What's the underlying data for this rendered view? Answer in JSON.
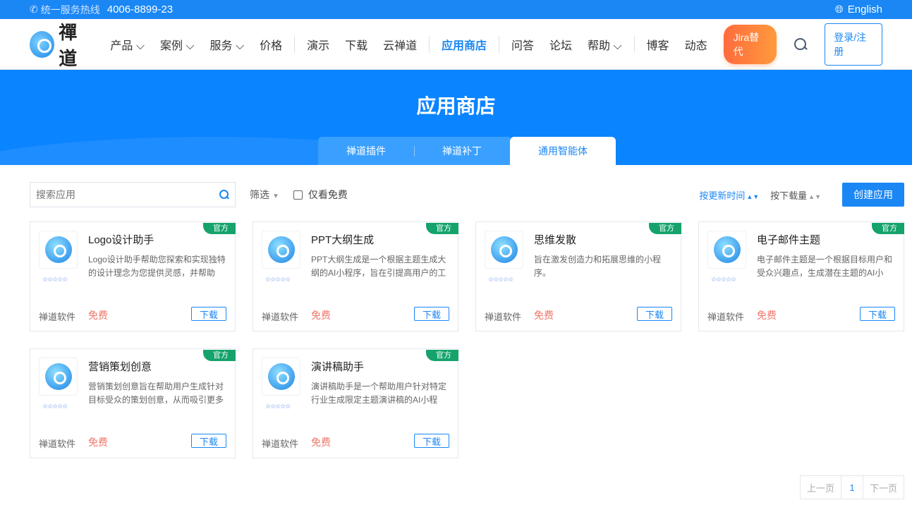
{
  "topbar": {
    "hotline_label": "统一服务热线",
    "phone": "4006-8899-23",
    "language": "English"
  },
  "nav": {
    "logo_text": "禪道",
    "items": [
      {
        "label": "产品 ⌵"
      },
      {
        "label": "案例 ⌵"
      },
      {
        "label": "服务 ⌵"
      },
      {
        "label": "价格"
      },
      {
        "label": "演示"
      },
      {
        "label": "下载"
      },
      {
        "label": "云禅道"
      },
      {
        "label": "应用商店"
      },
      {
        "label": "问答"
      },
      {
        "label": "论坛"
      },
      {
        "label": "帮助 ⌵"
      },
      {
        "label": "博客"
      },
      {
        "label": "动态"
      }
    ],
    "jira_label": "Jira替代",
    "login_label": "登录/注册"
  },
  "hero": {
    "title": "应用商店",
    "tabs": [
      {
        "label": "禅道插件"
      },
      {
        "label": "禅道补丁"
      },
      {
        "label": "通用智能体"
      }
    ]
  },
  "filter": {
    "search_placeholder": "搜索应用",
    "filter_label": "筛选",
    "free_only_label": "仅看免费",
    "sort_update": "按更新时间",
    "sort_downloads": "按下载量",
    "create_label": "创建应用"
  },
  "cards": [
    {
      "badge": "官方",
      "title": "Logo设计助手",
      "desc": "Logo设计助手帮助您探索和实现独特的设计理念为您提供灵感，并帮助",
      "stars": "☆☆☆☆☆",
      "vendor": "禅道软件",
      "price": "免费",
      "download": "下载"
    },
    {
      "badge": "官方",
      "title": "PPT大纲生成",
      "desc": "PPT大纲生成是一个根据主题生成大纲的AI小程序，旨在引提高用户的工",
      "stars": "☆☆☆☆☆",
      "vendor": "禅道软件",
      "price": "免费",
      "download": "下载"
    },
    {
      "badge": "官方",
      "title": "思维发散",
      "desc": "旨在激发创造力和拓展思维的小程序。",
      "stars": "☆☆☆☆☆",
      "vendor": "禅道软件",
      "price": "免费",
      "download": "下载"
    },
    {
      "badge": "官方",
      "title": "电子邮件主题",
      "desc": "电子邮件主题是一个根据目标用户和受众兴趣点，生成潜在主题的AI小",
      "stars": "☆☆☆☆☆",
      "vendor": "禅道软件",
      "price": "免费",
      "download": "下载"
    },
    {
      "badge": "官方",
      "title": "营销策划创意",
      "desc": "营销策划创意旨在帮助用户生成针对目标受众的策划创意，从而吸引更多",
      "stars": "☆☆☆☆☆",
      "vendor": "禅道软件",
      "price": "免费",
      "download": "下载"
    },
    {
      "badge": "官方",
      "title": "演讲稿助手",
      "desc": "演讲稿助手是一个帮助用户针对特定行业生成限定主题演讲稿的AI小程",
      "stars": "☆☆☆☆☆",
      "vendor": "禅道软件",
      "price": "免费",
      "download": "下载"
    }
  ],
  "pager": {
    "prev": "上一页",
    "current": "1",
    "next": "下一页"
  }
}
